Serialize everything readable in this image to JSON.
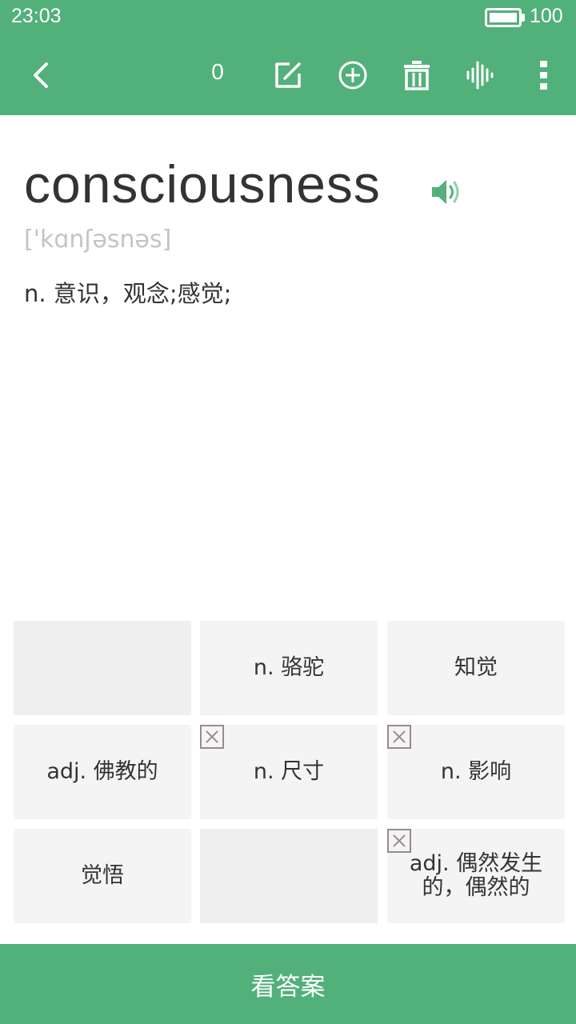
{
  "status_bar": {
    "time": "23:03",
    "battery": "100",
    "battery_level": 1.0
  },
  "toolbar": {
    "count": "0",
    "icons": [
      "back-icon",
      "edit-icon",
      "add-circle-icon",
      "trash-icon",
      "sound-wave-icon",
      "more-vertical-icon"
    ]
  },
  "word": {
    "text": "consciousness",
    "phonetic": "['kɑnʃəsnəs]",
    "definition": "n.  意识，观念;感觉;"
  },
  "options": [
    {
      "label": "",
      "wrong": false
    },
    {
      "label": "n.  骆驼",
      "wrong": false
    },
    {
      "label": "知觉",
      "wrong": false
    },
    {
      "label": "adj.  佛教的",
      "wrong": false
    },
    {
      "label": "n.  尺寸",
      "wrong": true
    },
    {
      "label": "n.  影响",
      "wrong": true
    },
    {
      "label": "觉悟",
      "wrong": false
    },
    {
      "label": "",
      "wrong": false
    },
    {
      "label": "adj.  偶然发生的，偶然的",
      "wrong": true
    }
  ],
  "answer_button": "看答案",
  "colors": {
    "accent": "#52b07a",
    "cell": "#f4f4f4",
    "text": "#333333",
    "phonetic": "#c4c4c4"
  }
}
